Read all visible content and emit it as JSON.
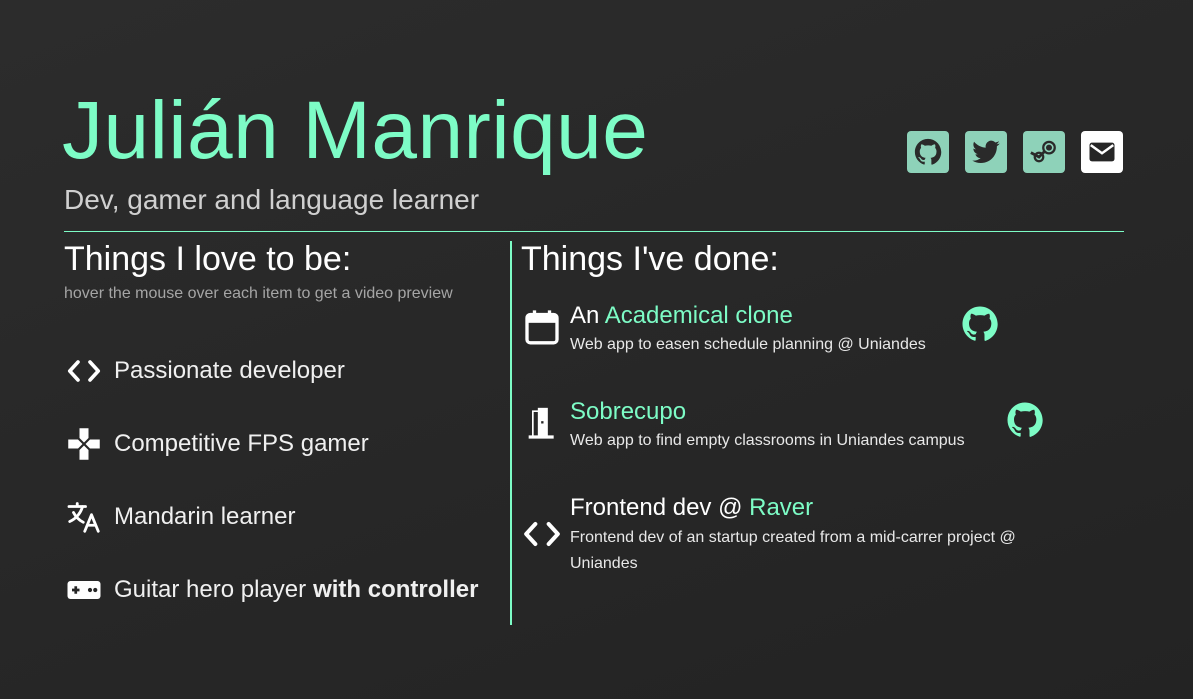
{
  "header": {
    "name": "Julián Manrique",
    "tagline": "Dev, gamer and language learner"
  },
  "socials": [
    {
      "icon": "github-icon"
    },
    {
      "icon": "twitter-icon"
    },
    {
      "icon": "steam-icon"
    },
    {
      "icon": "mail-icon"
    }
  ],
  "love": {
    "title": "Things I love to be:",
    "hint": "hover the mouse over each item to get a video preview",
    "items": [
      {
        "icon": "code-icon",
        "label": "Passionate developer"
      },
      {
        "icon": "gamepad-icon",
        "label": "Competitive FPS gamer"
      },
      {
        "icon": "translate-icon",
        "label": "Mandarin learner"
      },
      {
        "icon": "controller-icon",
        "label": "Guitar hero player",
        "emphasis": "with controller"
      }
    ]
  },
  "done": {
    "title": "Things I've done:",
    "items": [
      {
        "icon": "calendar-icon",
        "prefix": "An ",
        "link": "Academical clone",
        "desc": "Web app to easen schedule planning @ Uniandes",
        "repo_icon": "github-icon"
      },
      {
        "icon": "door-icon",
        "prefix": "",
        "link": "Sobrecupo",
        "desc": "Web app to find empty classrooms in Uniandes campus",
        "repo_icon": "github-icon"
      },
      {
        "icon": "code-icon",
        "prefix": "Frontend dev @ ",
        "link": "Raver",
        "desc": "Frontend dev of an startup created from a mid-carrer project @ Uniandes"
      }
    ]
  },
  "colors": {
    "accent": "#7dfcc6",
    "social_bg": "#8ed2b9",
    "background": "#262626"
  }
}
